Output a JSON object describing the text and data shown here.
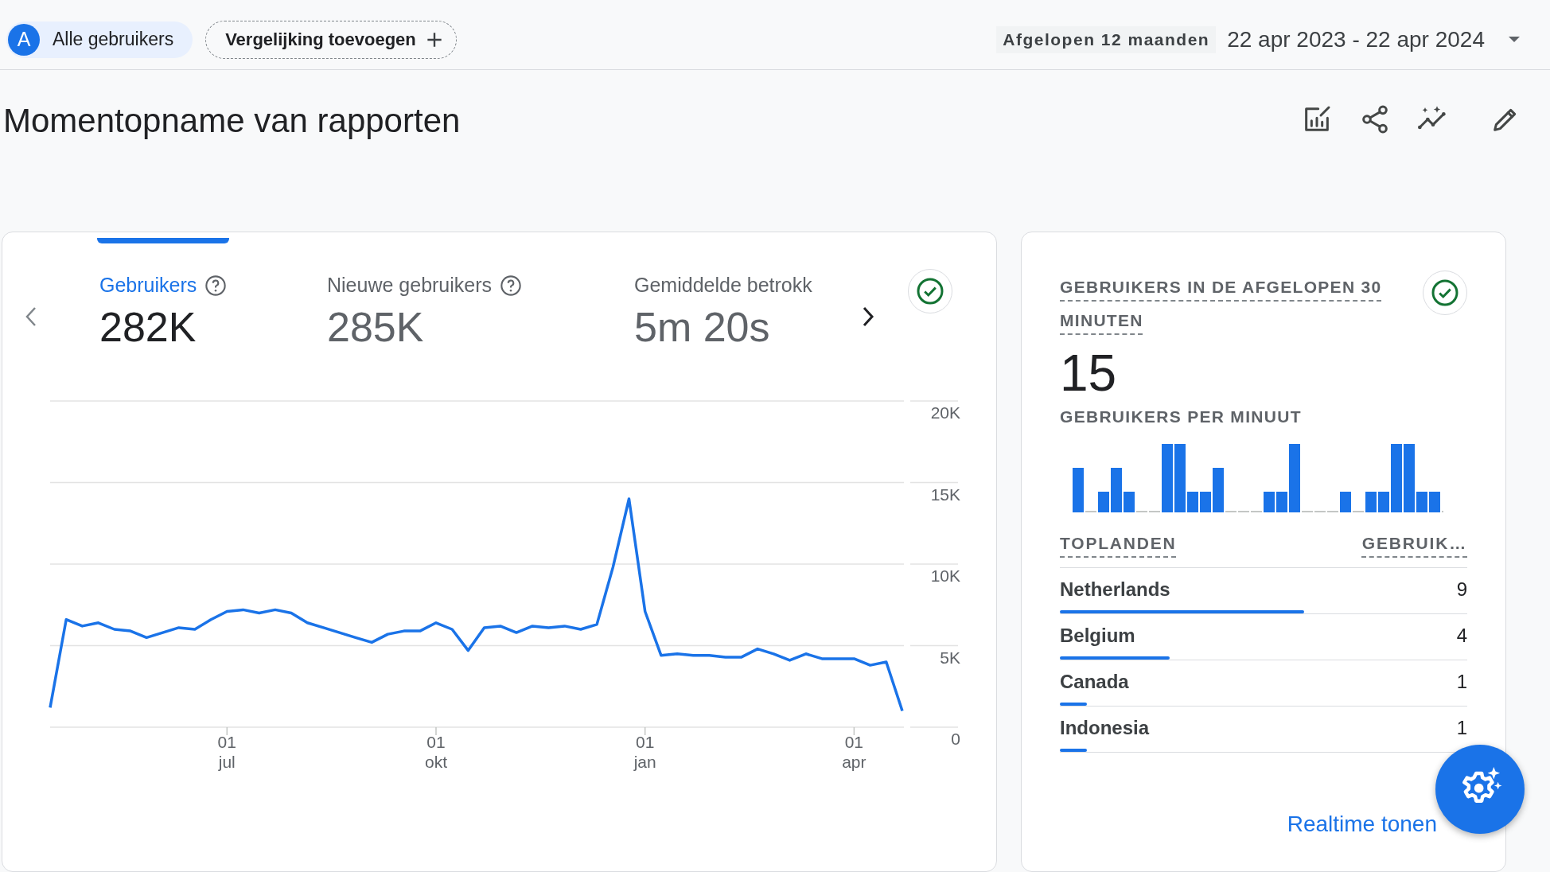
{
  "filter_bar": {
    "segment_chip": {
      "avatar_letter": "A",
      "label": "Alle gebruikers"
    },
    "compare_button": {
      "label": "Vergelijking toevoegen"
    },
    "date_range": {
      "preset": "Afgelopen 12 maanden",
      "range": "22 apr 2023 - 22 apr 2024"
    }
  },
  "page_title": "Momentopname van rapporten",
  "metrics_card": {
    "metric_tabs": [
      {
        "label": "Gebruikers",
        "value": "282K",
        "selected": true,
        "help": true
      },
      {
        "label": "Nieuwe gebruikers",
        "value": "285K",
        "selected": false,
        "help": true
      },
      {
        "label": "Gemiddelde betrokk",
        "value": "5m 20s",
        "selected": false,
        "help": false
      }
    ],
    "chart_data": {
      "type": "line",
      "categories": [
        null,
        null,
        null,
        null,
        null,
        null,
        null,
        null,
        null,
        null,
        null,
        "01 jul",
        null,
        null,
        null,
        null,
        null,
        null,
        null,
        null,
        null,
        null,
        null,
        null,
        "01 okt",
        null,
        null,
        null,
        null,
        null,
        null,
        null,
        null,
        null,
        null,
        null,
        null,
        "01 jan",
        null,
        null,
        null,
        null,
        null,
        null,
        null,
        null,
        null,
        null,
        null,
        null,
        "01 apr",
        null,
        null,
        null
      ],
      "series": [
        {
          "color": "#1a73e8",
          "values": [
            1200,
            6600,
            6200,
            6400,
            6000,
            5900,
            5500,
            5800,
            6100,
            6000,
            6600,
            7100,
            7200,
            7000,
            7200,
            7000,
            6400,
            6100,
            5800,
            5500,
            5200,
            5700,
            5900,
            5900,
            6400,
            6000,
            4700,
            6100,
            6200,
            5800,
            6200,
            6100,
            6200,
            6000,
            6300,
            9800,
            14000,
            7100,
            4400,
            4500,
            4400,
            4400,
            4300,
            4300,
            4800,
            4500,
            4100,
            4500,
            4200,
            4200,
            4200,
            3800,
            4000,
            1000
          ]
        }
      ],
      "ylim": [
        0,
        20000
      ],
      "grid": true,
      "yticks": [
        {
          "value": 0,
          "label": "0"
        },
        {
          "value": 5000,
          "label": "5K"
        },
        {
          "value": 10000,
          "label": "10K"
        },
        {
          "value": 15000,
          "label": "15K"
        },
        {
          "value": 20000,
          "label": "20K"
        }
      ]
    }
  },
  "realtime_card": {
    "title": "GEBRUIKERS IN DE AFGELOPEN 30 MINUTEN",
    "count": "15",
    "per_minute_label": "GEBRUIKERS PER MINUUT",
    "table": {
      "columns": [
        "TOPLANDEN",
        "GEBRUIK…"
      ],
      "rows": [
        {
          "country": "Netherlands",
          "users": "9",
          "level": 0.6
        },
        {
          "country": "Belgium",
          "users": "4",
          "level": 0.27
        },
        {
          "country": "Canada",
          "users": "1",
          "level": 0.067
        },
        {
          "country": "Indonesia",
          "users": "1",
          "level": 0.067
        }
      ]
    },
    "link": "Realtime tonen"
  }
}
